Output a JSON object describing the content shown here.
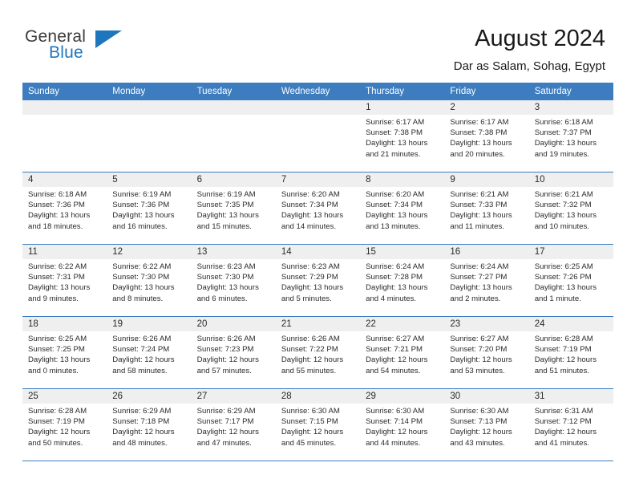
{
  "brand": {
    "line1": "General",
    "line2": "Blue",
    "triangle_color": "#1f76bc"
  },
  "header": {
    "month_title": "August 2024",
    "location": "Dar as Salam, Sohag, Egypt"
  },
  "theme": {
    "header_blue": "#3c7cbf",
    "day_band_gray": "#efefef",
    "text_dark": "#2b2b2b"
  },
  "calendar": {
    "weekday_headers": [
      "Sunday",
      "Monday",
      "Tuesday",
      "Wednesday",
      "Thursday",
      "Friday",
      "Saturday"
    ],
    "weeks": [
      [
        {
          "day": "",
          "sunrise": "",
          "sunset": "",
          "daylight_line1": "",
          "daylight_line2": ""
        },
        {
          "day": "",
          "sunrise": "",
          "sunset": "",
          "daylight_line1": "",
          "daylight_line2": ""
        },
        {
          "day": "",
          "sunrise": "",
          "sunset": "",
          "daylight_line1": "",
          "daylight_line2": ""
        },
        {
          "day": "",
          "sunrise": "",
          "sunset": "",
          "daylight_line1": "",
          "daylight_line2": ""
        },
        {
          "day": "1",
          "sunrise": "Sunrise: 6:17 AM",
          "sunset": "Sunset: 7:38 PM",
          "daylight_line1": "Daylight: 13 hours",
          "daylight_line2": "and 21 minutes."
        },
        {
          "day": "2",
          "sunrise": "Sunrise: 6:17 AM",
          "sunset": "Sunset: 7:38 PM",
          "daylight_line1": "Daylight: 13 hours",
          "daylight_line2": "and 20 minutes."
        },
        {
          "day": "3",
          "sunrise": "Sunrise: 6:18 AM",
          "sunset": "Sunset: 7:37 PM",
          "daylight_line1": "Daylight: 13 hours",
          "daylight_line2": "and 19 minutes."
        }
      ],
      [
        {
          "day": "4",
          "sunrise": "Sunrise: 6:18 AM",
          "sunset": "Sunset: 7:36 PM",
          "daylight_line1": "Daylight: 13 hours",
          "daylight_line2": "and 18 minutes."
        },
        {
          "day": "5",
          "sunrise": "Sunrise: 6:19 AM",
          "sunset": "Sunset: 7:36 PM",
          "daylight_line1": "Daylight: 13 hours",
          "daylight_line2": "and 16 minutes."
        },
        {
          "day": "6",
          "sunrise": "Sunrise: 6:19 AM",
          "sunset": "Sunset: 7:35 PM",
          "daylight_line1": "Daylight: 13 hours",
          "daylight_line2": "and 15 minutes."
        },
        {
          "day": "7",
          "sunrise": "Sunrise: 6:20 AM",
          "sunset": "Sunset: 7:34 PM",
          "daylight_line1": "Daylight: 13 hours",
          "daylight_line2": "and 14 minutes."
        },
        {
          "day": "8",
          "sunrise": "Sunrise: 6:20 AM",
          "sunset": "Sunset: 7:34 PM",
          "daylight_line1": "Daylight: 13 hours",
          "daylight_line2": "and 13 minutes."
        },
        {
          "day": "9",
          "sunrise": "Sunrise: 6:21 AM",
          "sunset": "Sunset: 7:33 PM",
          "daylight_line1": "Daylight: 13 hours",
          "daylight_line2": "and 11 minutes."
        },
        {
          "day": "10",
          "sunrise": "Sunrise: 6:21 AM",
          "sunset": "Sunset: 7:32 PM",
          "daylight_line1": "Daylight: 13 hours",
          "daylight_line2": "and 10 minutes."
        }
      ],
      [
        {
          "day": "11",
          "sunrise": "Sunrise: 6:22 AM",
          "sunset": "Sunset: 7:31 PM",
          "daylight_line1": "Daylight: 13 hours",
          "daylight_line2": "and 9 minutes."
        },
        {
          "day": "12",
          "sunrise": "Sunrise: 6:22 AM",
          "sunset": "Sunset: 7:30 PM",
          "daylight_line1": "Daylight: 13 hours",
          "daylight_line2": "and 8 minutes."
        },
        {
          "day": "13",
          "sunrise": "Sunrise: 6:23 AM",
          "sunset": "Sunset: 7:30 PM",
          "daylight_line1": "Daylight: 13 hours",
          "daylight_line2": "and 6 minutes."
        },
        {
          "day": "14",
          "sunrise": "Sunrise: 6:23 AM",
          "sunset": "Sunset: 7:29 PM",
          "daylight_line1": "Daylight: 13 hours",
          "daylight_line2": "and 5 minutes."
        },
        {
          "day": "15",
          "sunrise": "Sunrise: 6:24 AM",
          "sunset": "Sunset: 7:28 PM",
          "daylight_line1": "Daylight: 13 hours",
          "daylight_line2": "and 4 minutes."
        },
        {
          "day": "16",
          "sunrise": "Sunrise: 6:24 AM",
          "sunset": "Sunset: 7:27 PM",
          "daylight_line1": "Daylight: 13 hours",
          "daylight_line2": "and 2 minutes."
        },
        {
          "day": "17",
          "sunrise": "Sunrise: 6:25 AM",
          "sunset": "Sunset: 7:26 PM",
          "daylight_line1": "Daylight: 13 hours",
          "daylight_line2": "and 1 minute."
        }
      ],
      [
        {
          "day": "18",
          "sunrise": "Sunrise: 6:25 AM",
          "sunset": "Sunset: 7:25 PM",
          "daylight_line1": "Daylight: 13 hours",
          "daylight_line2": "and 0 minutes."
        },
        {
          "day": "19",
          "sunrise": "Sunrise: 6:26 AM",
          "sunset": "Sunset: 7:24 PM",
          "daylight_line1": "Daylight: 12 hours",
          "daylight_line2": "and 58 minutes."
        },
        {
          "day": "20",
          "sunrise": "Sunrise: 6:26 AM",
          "sunset": "Sunset: 7:23 PM",
          "daylight_line1": "Daylight: 12 hours",
          "daylight_line2": "and 57 minutes."
        },
        {
          "day": "21",
          "sunrise": "Sunrise: 6:26 AM",
          "sunset": "Sunset: 7:22 PM",
          "daylight_line1": "Daylight: 12 hours",
          "daylight_line2": "and 55 minutes."
        },
        {
          "day": "22",
          "sunrise": "Sunrise: 6:27 AM",
          "sunset": "Sunset: 7:21 PM",
          "daylight_line1": "Daylight: 12 hours",
          "daylight_line2": "and 54 minutes."
        },
        {
          "day": "23",
          "sunrise": "Sunrise: 6:27 AM",
          "sunset": "Sunset: 7:20 PM",
          "daylight_line1": "Daylight: 12 hours",
          "daylight_line2": "and 53 minutes."
        },
        {
          "day": "24",
          "sunrise": "Sunrise: 6:28 AM",
          "sunset": "Sunset: 7:19 PM",
          "daylight_line1": "Daylight: 12 hours",
          "daylight_line2": "and 51 minutes."
        }
      ],
      [
        {
          "day": "25",
          "sunrise": "Sunrise: 6:28 AM",
          "sunset": "Sunset: 7:19 PM",
          "daylight_line1": "Daylight: 12 hours",
          "daylight_line2": "and 50 minutes."
        },
        {
          "day": "26",
          "sunrise": "Sunrise: 6:29 AM",
          "sunset": "Sunset: 7:18 PM",
          "daylight_line1": "Daylight: 12 hours",
          "daylight_line2": "and 48 minutes."
        },
        {
          "day": "27",
          "sunrise": "Sunrise: 6:29 AM",
          "sunset": "Sunset: 7:17 PM",
          "daylight_line1": "Daylight: 12 hours",
          "daylight_line2": "and 47 minutes."
        },
        {
          "day": "28",
          "sunrise": "Sunrise: 6:30 AM",
          "sunset": "Sunset: 7:15 PM",
          "daylight_line1": "Daylight: 12 hours",
          "daylight_line2": "and 45 minutes."
        },
        {
          "day": "29",
          "sunrise": "Sunrise: 6:30 AM",
          "sunset": "Sunset: 7:14 PM",
          "daylight_line1": "Daylight: 12 hours",
          "daylight_line2": "and 44 minutes."
        },
        {
          "day": "30",
          "sunrise": "Sunrise: 6:30 AM",
          "sunset": "Sunset: 7:13 PM",
          "daylight_line1": "Daylight: 12 hours",
          "daylight_line2": "and 43 minutes."
        },
        {
          "day": "31",
          "sunrise": "Sunrise: 6:31 AM",
          "sunset": "Sunset: 7:12 PM",
          "daylight_line1": "Daylight: 12 hours",
          "daylight_line2": "and 41 minutes."
        }
      ]
    ]
  }
}
